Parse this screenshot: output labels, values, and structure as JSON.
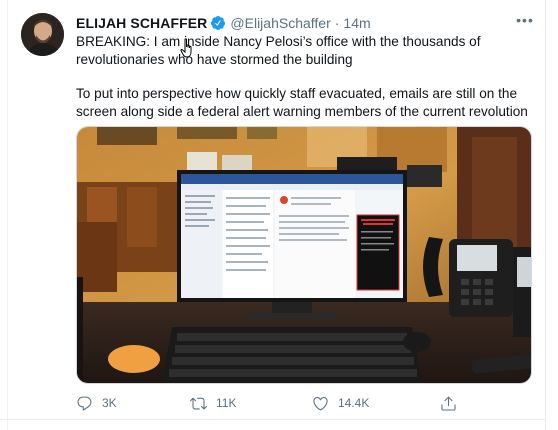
{
  "tweet": {
    "author_name": "ELIJAH SCHAFFER",
    "handle": "@ElijahSchaffer",
    "separator": "·",
    "time": "14m",
    "more_label": "•••",
    "paragraph_1": "BREAKING: I am inside Nancy Pelosi’s office with the thousands of revolutionaries who have stormed the building",
    "paragraph_2": "To put into perspective how quickly staff evacuated, emails are still on the screen along side a federal alert warning members of the current revolution"
  },
  "actions": {
    "reply_count": "3K",
    "retweet_count": "11K",
    "like_count": "14.4K"
  },
  "colors": {
    "text_primary": "#0f1419",
    "text_secondary": "#5b7083",
    "verified_blue": "#1d9bf0",
    "border": "#cfd9de"
  },
  "icons": {
    "verified": "verified-badge-icon",
    "reply": "reply-icon",
    "retweet": "retweet-icon",
    "like": "heart-icon",
    "share": "share-icon",
    "more": "more-icon"
  }
}
